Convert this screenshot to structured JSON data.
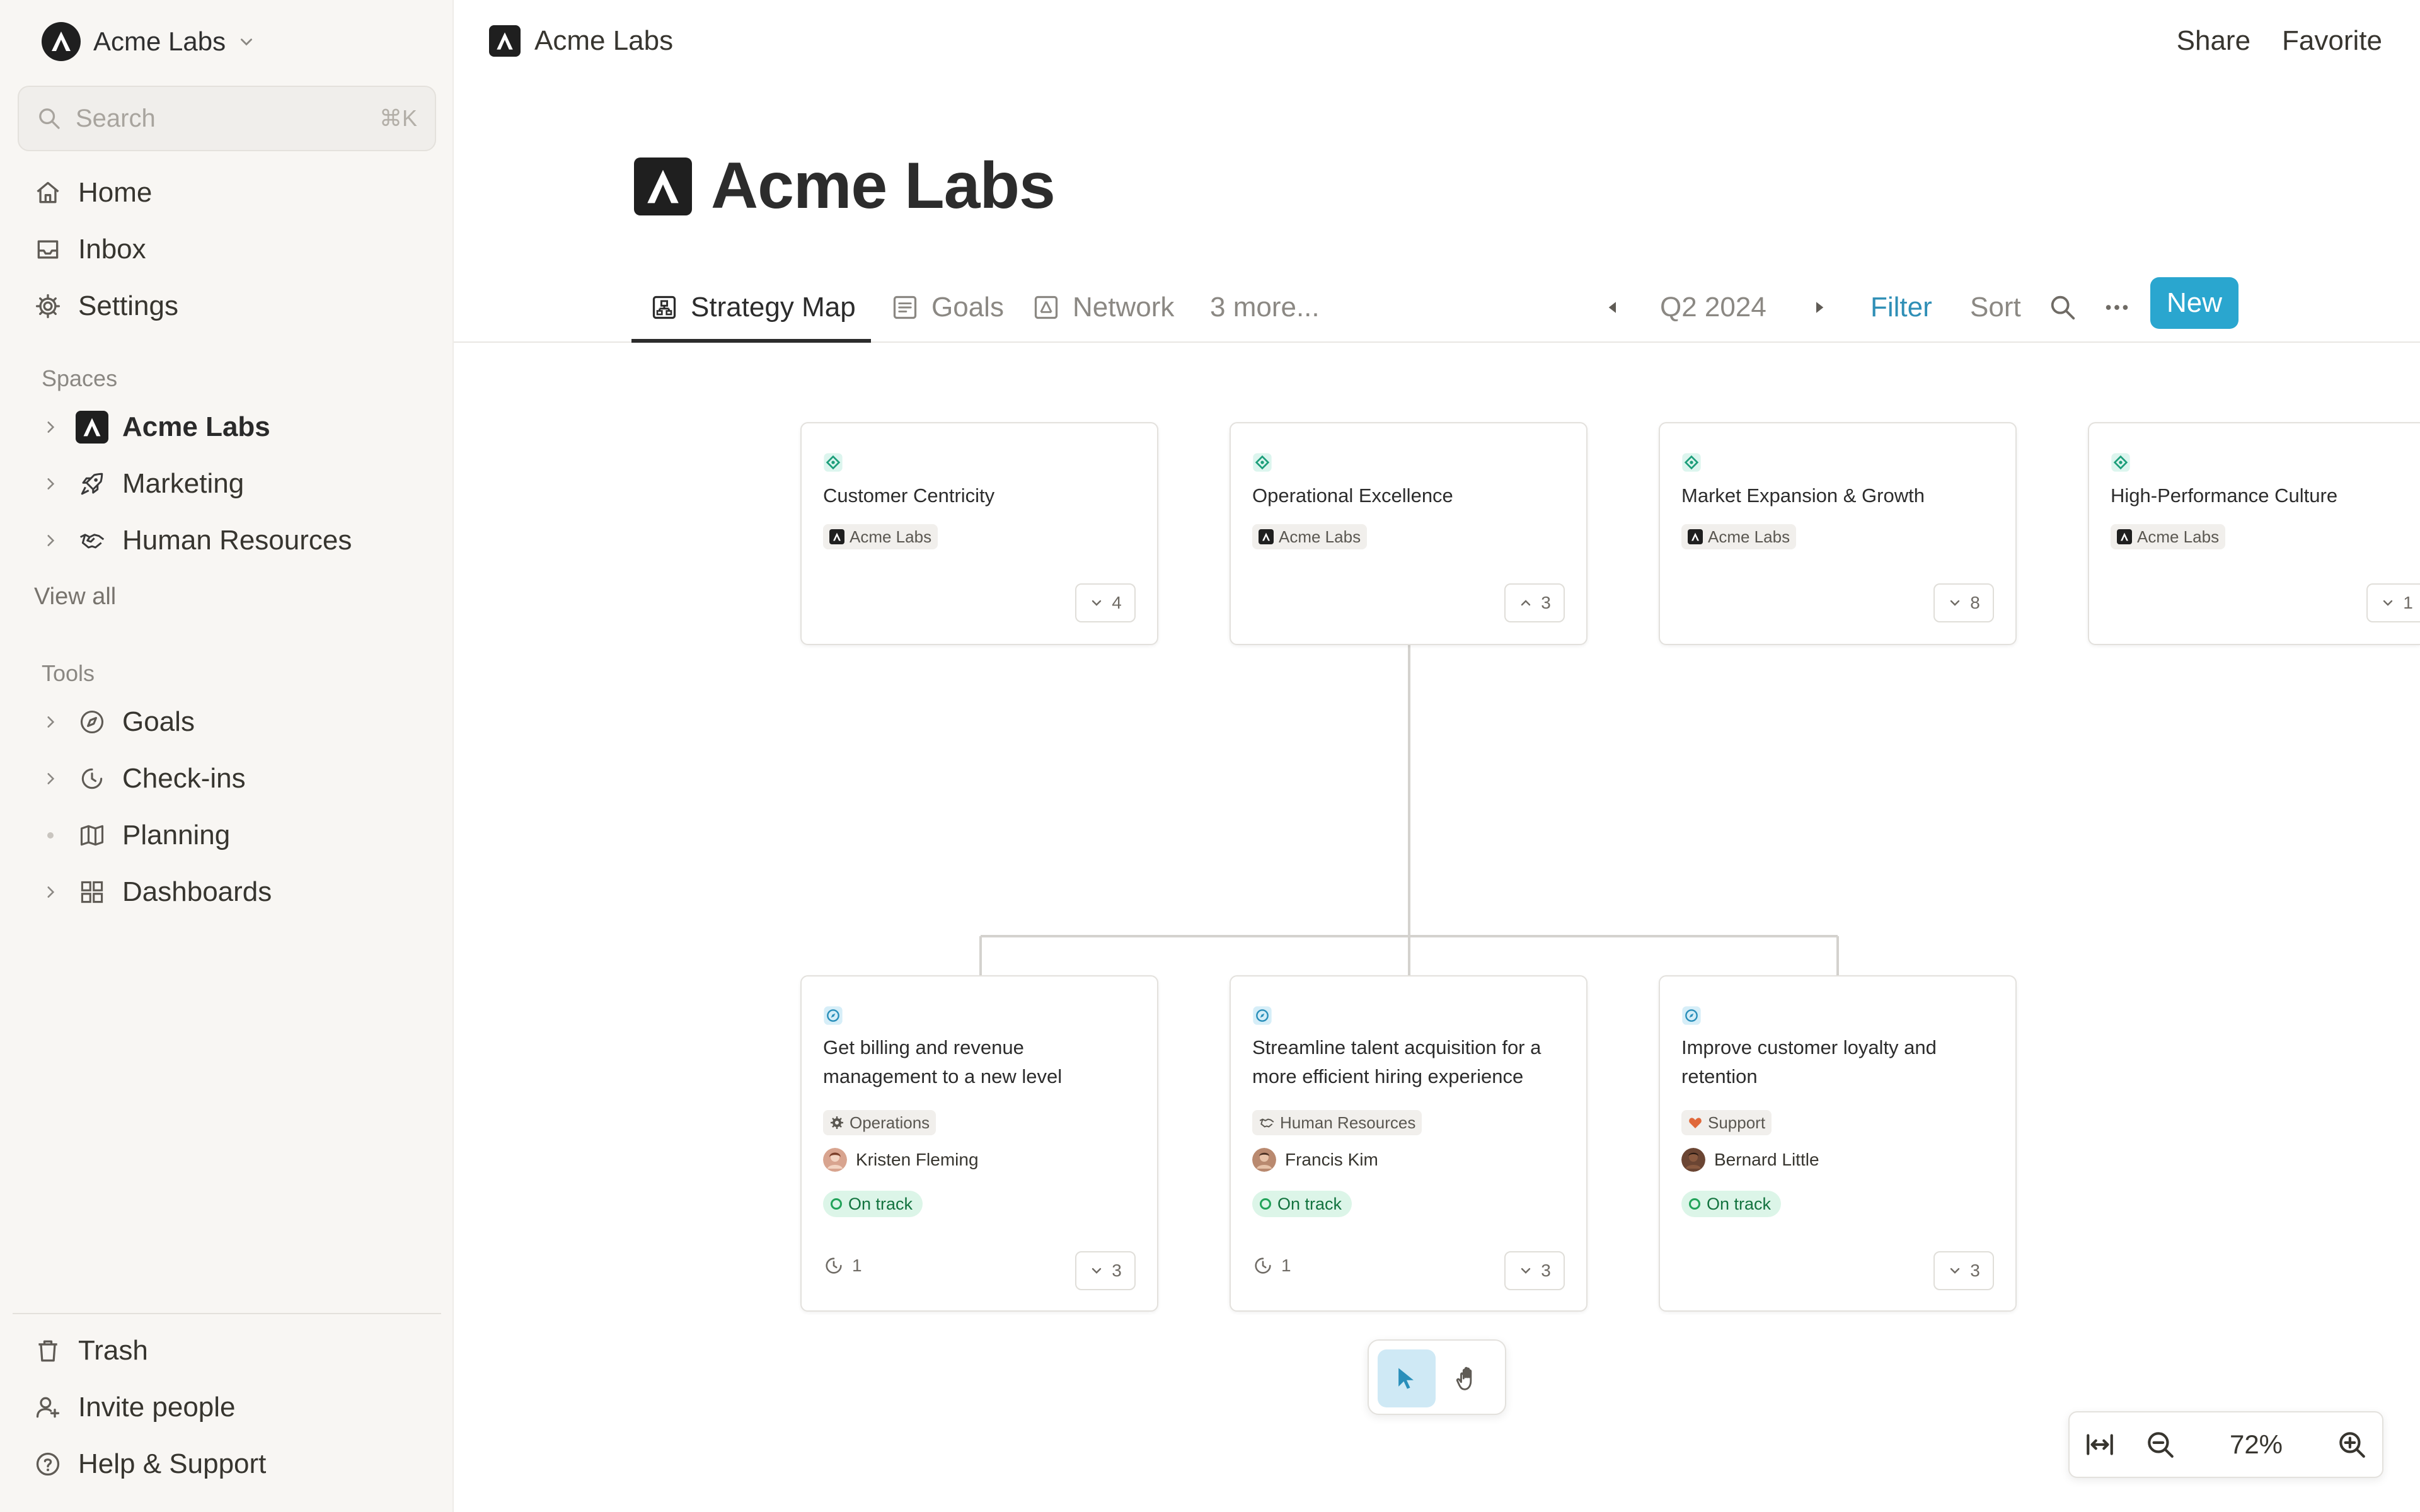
{
  "sidebar": {
    "workspace_name": "Acme Labs",
    "search_placeholder": "Search",
    "search_shortcut": "⌘K",
    "nav": [
      {
        "label": "Home",
        "icon": "home-icon"
      },
      {
        "label": "Inbox",
        "icon": "inbox-icon"
      },
      {
        "label": "Settings",
        "icon": "gear-icon"
      }
    ],
    "spaces_label": "Spaces",
    "spaces": [
      {
        "label": "Acme Labs",
        "icon": "acme-logo-icon"
      },
      {
        "label": "Marketing",
        "icon": "rocket-icon"
      },
      {
        "label": "Human Resources",
        "icon": "handshake-icon"
      }
    ],
    "view_all": "View all",
    "tools_label": "Tools",
    "tools": [
      {
        "label": "Goals",
        "icon": "compass-icon"
      },
      {
        "label": "Check-ins",
        "icon": "clock-icon"
      },
      {
        "label": "Planning",
        "icon": "map-icon"
      },
      {
        "label": "Dashboards",
        "icon": "grid-icon"
      }
    ],
    "footer": [
      {
        "label": "Trash",
        "icon": "trash-icon"
      },
      {
        "label": "Invite people",
        "icon": "invite-icon"
      },
      {
        "label": "Help & Support",
        "icon": "help-icon"
      }
    ]
  },
  "topbar": {
    "breadcrumb": "Acme Labs",
    "share": "Share",
    "favorite": "Favorite"
  },
  "page": {
    "title": "Acme Labs"
  },
  "tabs": [
    {
      "label": "Strategy Map",
      "icon": "hierarchy-icon",
      "active": true
    },
    {
      "label": "Goals",
      "icon": "list-icon",
      "active": false
    },
    {
      "label": "Network",
      "icon": "network-icon",
      "active": false
    }
  ],
  "tabs_more": "3 more...",
  "period": {
    "label": "Q2 2024",
    "filter": "Filter",
    "sort": "Sort",
    "new": "New"
  },
  "strategy_cards": [
    {
      "title": "Customer Centricity",
      "space": "Acme Labs",
      "count": "4",
      "expanded": false
    },
    {
      "title": "Operational Excellence",
      "space": "Acme Labs",
      "count": "3",
      "expanded": true
    },
    {
      "title": "Market Expansion & Growth",
      "space": "Acme Labs",
      "count": "8",
      "expanded": false
    },
    {
      "title": "High-Performance Culture",
      "space": "Acme Labs",
      "count": "1",
      "expanded": false
    }
  ],
  "goal_cards": [
    {
      "title": "Get billing and revenue management to a new level",
      "team": "Operations",
      "owner": "Kristen Fleming",
      "status": "On track",
      "checkins": "1",
      "count": "3"
    },
    {
      "title": "Streamline talent acquisition for a more efficient hiring experience",
      "team": "Human Resources",
      "owner": "Francis Kim",
      "status": "On track",
      "checkins": "1",
      "count": "3"
    },
    {
      "title": "Improve customer loyalty and retention",
      "team": "Support",
      "owner": "Bernard Little",
      "status": "On track",
      "checkins": "",
      "count": "3"
    }
  ],
  "zoom": {
    "value": "72%"
  },
  "colors": {
    "accent": "#2aa6cf",
    "status_green": "#22a35a",
    "sidebar_bg": "#f8f6f3"
  }
}
